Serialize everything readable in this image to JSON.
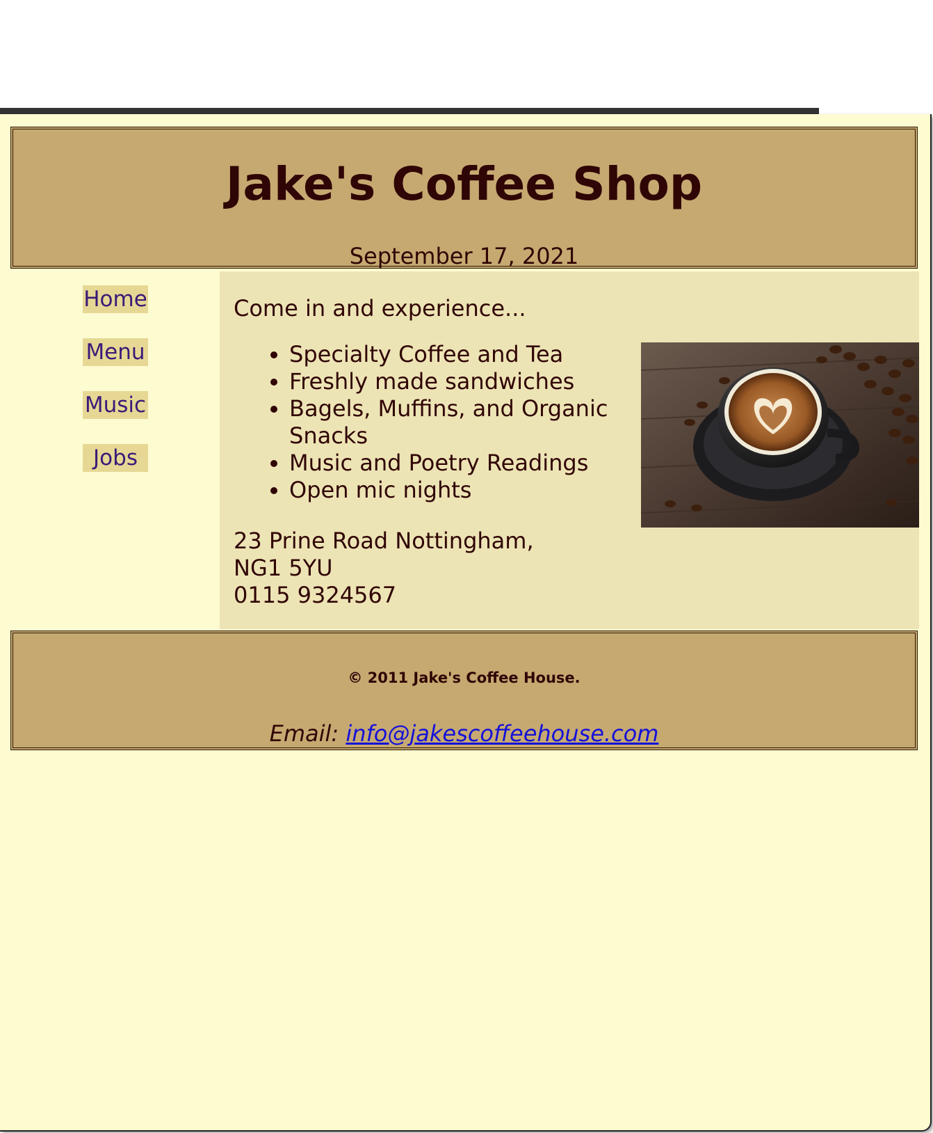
{
  "header": {
    "title": "Jake's Coffee Shop",
    "date": "September 17, 2021"
  },
  "nav": {
    "items": [
      {
        "label": "Home"
      },
      {
        "label": "Menu"
      },
      {
        "label": "Music"
      },
      {
        "label": "Jobs"
      }
    ]
  },
  "main": {
    "intro": "Come in and experience...",
    "features": [
      "Specialty Coffee and Tea",
      "Freshly made sandwiches",
      "Bagels, Muffins, and Organic Snacks",
      "Music and Poetry Readings",
      "Open mic nights"
    ],
    "address": {
      "line1": "23 Prine Road Nottingham,",
      "line2": "NG1 5YU",
      "phone": "0115 9324567"
    }
  },
  "footer": {
    "copyright": "© 2011 Jake's Coffee House.",
    "email_label": "Email:",
    "email": "info@jakescoffeehouse.com"
  },
  "colors": {
    "page_bg": "#fdfbd0",
    "header_bg": "#c6a971",
    "content_bg": "#ede4b5",
    "text": "#300505",
    "nav_link": "#3b1a78",
    "nav_bg": "#e6d894",
    "email_link": "#1411d8"
  },
  "icons": {
    "photo": "coffee-cup-latte-art-photo"
  }
}
